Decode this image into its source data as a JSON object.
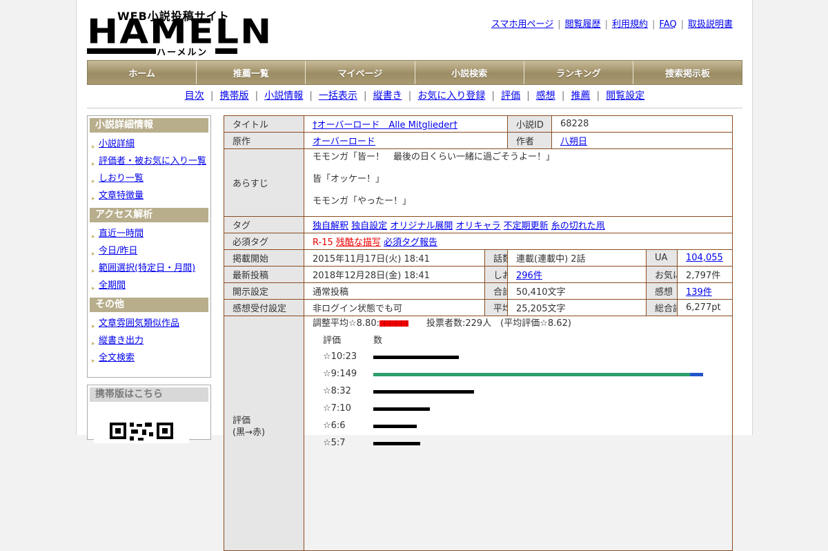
{
  "site": {
    "tagline": "WEB小説投稿サイト",
    "logo": "HAMELN",
    "logo_kana": "ハーメルン"
  },
  "top_links": [
    "スマホ用ページ",
    "閲覧履歴",
    "利用規約",
    "FAQ",
    "取扱説明書"
  ],
  "global_nav": [
    "ホーム",
    "推薦一覧",
    "マイページ",
    "小説検索",
    "ランキング",
    "捜索掲示板"
  ],
  "sub_nav": [
    "目次",
    "携帯版",
    "小説情報",
    "一括表示",
    "縦書き",
    "お気に入り登録",
    "評価",
    "感想",
    "推薦",
    "閲覧設定"
  ],
  "sidebar": [
    {
      "title": "小説詳細情報",
      "items": [
        "小説詳細",
        "評価者・被お気に入り一覧",
        "しおり一覧",
        "文章特徴量"
      ]
    },
    {
      "title": "アクセス解析",
      "items": [
        "直近一時間",
        "今日/昨日",
        "範囲選択(特定日・月間)",
        "全期間"
      ]
    },
    {
      "title": "その他",
      "items": [
        "文章雰囲気類似作品",
        "縦書き出力",
        "全文検索"
      ]
    }
  ],
  "mobile_box": {
    "title": "携帯版はこちら"
  },
  "info": {
    "title_label": "タイトル",
    "title": "†オーバーロード　Alle Mitglieder†",
    "id_label": "小説ID",
    "id": "68228",
    "original_label": "原作",
    "original": "オーバーロード",
    "author_label": "作者",
    "author": "八朔日",
    "synopsis_label": "あらすじ",
    "synopsis": [
      "モモンガ「皆ー！　最後の日くらい一緒に過ごそうよー！」",
      "皆「オッケー！」",
      "モモンガ「やったー！」"
    ],
    "tags_label": "タグ",
    "tags": [
      "独自解釈",
      "独自設定",
      "オリジナル展開",
      "オリキャラ",
      "不定期更新",
      "糸の切れた凧"
    ],
    "req_tags_label": "必須タグ",
    "req_tags": [
      "R-15",
      "残酷な描写"
    ],
    "req_report": "必須タグ報告",
    "start_label": "掲載開始",
    "start": "2015年11月17日(火) 18:41",
    "episodes_label": "話数",
    "episodes": "連載(連載中) 2話",
    "ua_label": "UA",
    "ua": "104,055",
    "latest_label": "最新投稿",
    "latest": "2018年12月28日(金) 18:41",
    "bookmarks_label": "しおり",
    "bookmarks": "296件",
    "favorites_label": "お気に入り",
    "favorites": "2,797件",
    "open_label": "開示設定",
    "open": "通常投稿",
    "total_chars_label": "合計文字数",
    "total_chars": "50,410文字",
    "reviews_label": "感想",
    "reviews": "139件",
    "review_accept_label": "感想受付設定",
    "review_accept": "非ログイン状態でも可",
    "avg_chars_label": "平均文字数",
    "avg_chars": "25,205文字",
    "overall_label": "総合評価",
    "overall": "6,277pt",
    "rating_label": "評価",
    "rating_sub": "(黒→赤)",
    "rating_avg": "調整平均☆8.80:",
    "voters": "投票者数:229人　(平均評価☆8.62)",
    "rating_head_score": "評価",
    "rating_head_count": "数"
  },
  "chart_data": {
    "type": "bar",
    "orientation": "horizontal",
    "categories": [
      "☆10:23",
      "☆9:149",
      "☆8:32",
      "☆7:10",
      "☆6:6",
      "☆5:7"
    ],
    "values": [
      23,
      149,
      32,
      10,
      6,
      7
    ],
    "colors": [
      "#000000",
      "#2e9e6e",
      "#000000",
      "#000000",
      "#000000",
      "#000000"
    ]
  }
}
